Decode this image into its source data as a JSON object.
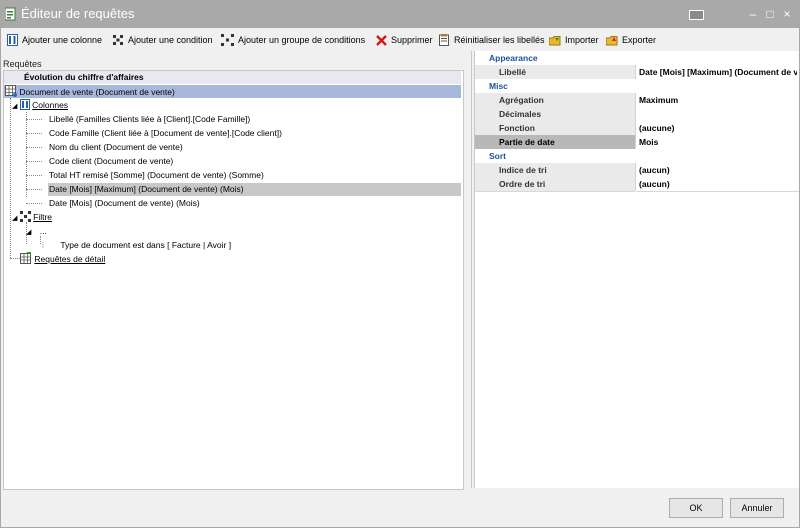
{
  "window": {
    "title": "Éditeur de requêtes",
    "controls": {
      "minimize": "–",
      "maximize": "□",
      "close": "×"
    }
  },
  "toolbar": {
    "add_column": "Ajouter une colonne",
    "add_condition": "Ajouter une condition",
    "add_condition_group": "Ajouter un groupe de conditions",
    "delete": "Supprimer",
    "reset_labels": "Réinitialiser les libellés",
    "import": "Importer",
    "export": "Exporter"
  },
  "left": {
    "label": "Requêtes",
    "header": "Évolution du chiffre d'affaires",
    "root": "Document de vente (Document de vente)",
    "columns_label": "Colonnes",
    "columns": [
      "Libellé (Familles Clients liée à [Client].[Code Famille])",
      "Code Famille (Client liée à [Document de vente].[Code client])",
      "Nom du client (Document de vente)",
      "Code client (Document de vente)",
      "Total HT remisé [Somme] (Document de vente) (Somme)",
      "Date [Mois] [Maximum] (Document de vente) (Mois)",
      "Date [Mois] (Document de vente) (Mois)"
    ],
    "filter_label": "Filtre",
    "filter_group": "...",
    "filter_condition": "Type de document est dans [ Facture | Avoir ]",
    "detail_label": "Requêtes de détail"
  },
  "props": {
    "cat_appearance": "Appearance",
    "libelle_name": "Libellé",
    "libelle_value": "Date [Mois] [Maximum] (Document de vente) (Mois)",
    "cat_misc": "Misc",
    "aggregation_name": "Agrégation",
    "aggregation_value": "Maximum",
    "decimals_name": "Décimales",
    "decimals_value": "",
    "function_name": "Fonction",
    "function_value": "(aucune)",
    "datepart_name": "Partie de date",
    "datepart_value": "Mois",
    "cat_sort": "Sort",
    "sortindex_name": "Indice de tri",
    "sortindex_value": "(aucun)",
    "sortorder_name": "Ordre de tri",
    "sortorder_value": "(aucun)"
  },
  "buttons": {
    "ok": "OK",
    "cancel": "Annuler"
  },
  "colors": {
    "titlebar": "#a9a9a9",
    "selection_root": "#a8b8dc",
    "selection_item": "#c8c8c8",
    "category_text": "#1f4f9f"
  }
}
